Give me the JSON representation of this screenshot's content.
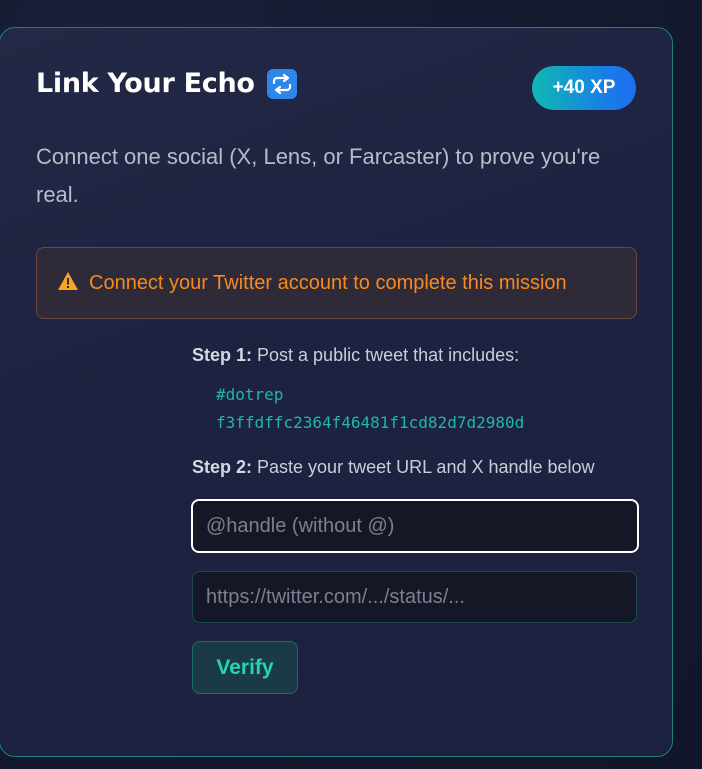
{
  "card": {
    "title": "Link Your Echo",
    "title_icon": "repeat-icon",
    "xp_badge": "+40 XP",
    "description": "Connect one social (X, Lens, or Farcaster) to prove you're real."
  },
  "warning": {
    "icon": "warning-icon",
    "text": "Connect your Twitter account to complete this mission"
  },
  "steps": {
    "step1_label": "Step 1:",
    "step1_text": " Post a public tweet that includes:",
    "code_line1": "#dotrep",
    "code_line2": "f3ffdffc2364f46481f1cd82d7d2980d",
    "step2_label": "Step 2:",
    "step2_text": " Paste your tweet URL and X handle below"
  },
  "form": {
    "handle_placeholder": "@handle (without @)",
    "url_placeholder": "https://twitter.com/.../status/...",
    "verify_label": "Verify"
  },
  "colors": {
    "accent_teal": "#26d3b4",
    "warning_orange": "#f68a1e",
    "card_border": "#1f7f7a"
  }
}
